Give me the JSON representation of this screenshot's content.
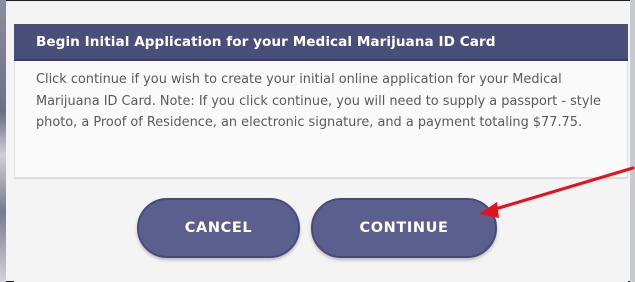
{
  "dialog": {
    "title": "Begin Initial Application for your Medical Marijuana ID Card",
    "message": "Click continue if you wish to create your initial online application for your Medical Marijuana ID Card. Note: If you click continue, you will need to supply a passport - style photo, a Proof of Residence, an electronic signature, and a payment totaling $77.75.",
    "cancel_label": "CANCEL",
    "continue_label": "CONTINUE"
  },
  "colors": {
    "header_bg": "#4a4f7a",
    "button_bg": "#5b5f8d",
    "arrow": "#e3121b"
  },
  "annotation": {
    "icon": "red-arrow-icon"
  }
}
